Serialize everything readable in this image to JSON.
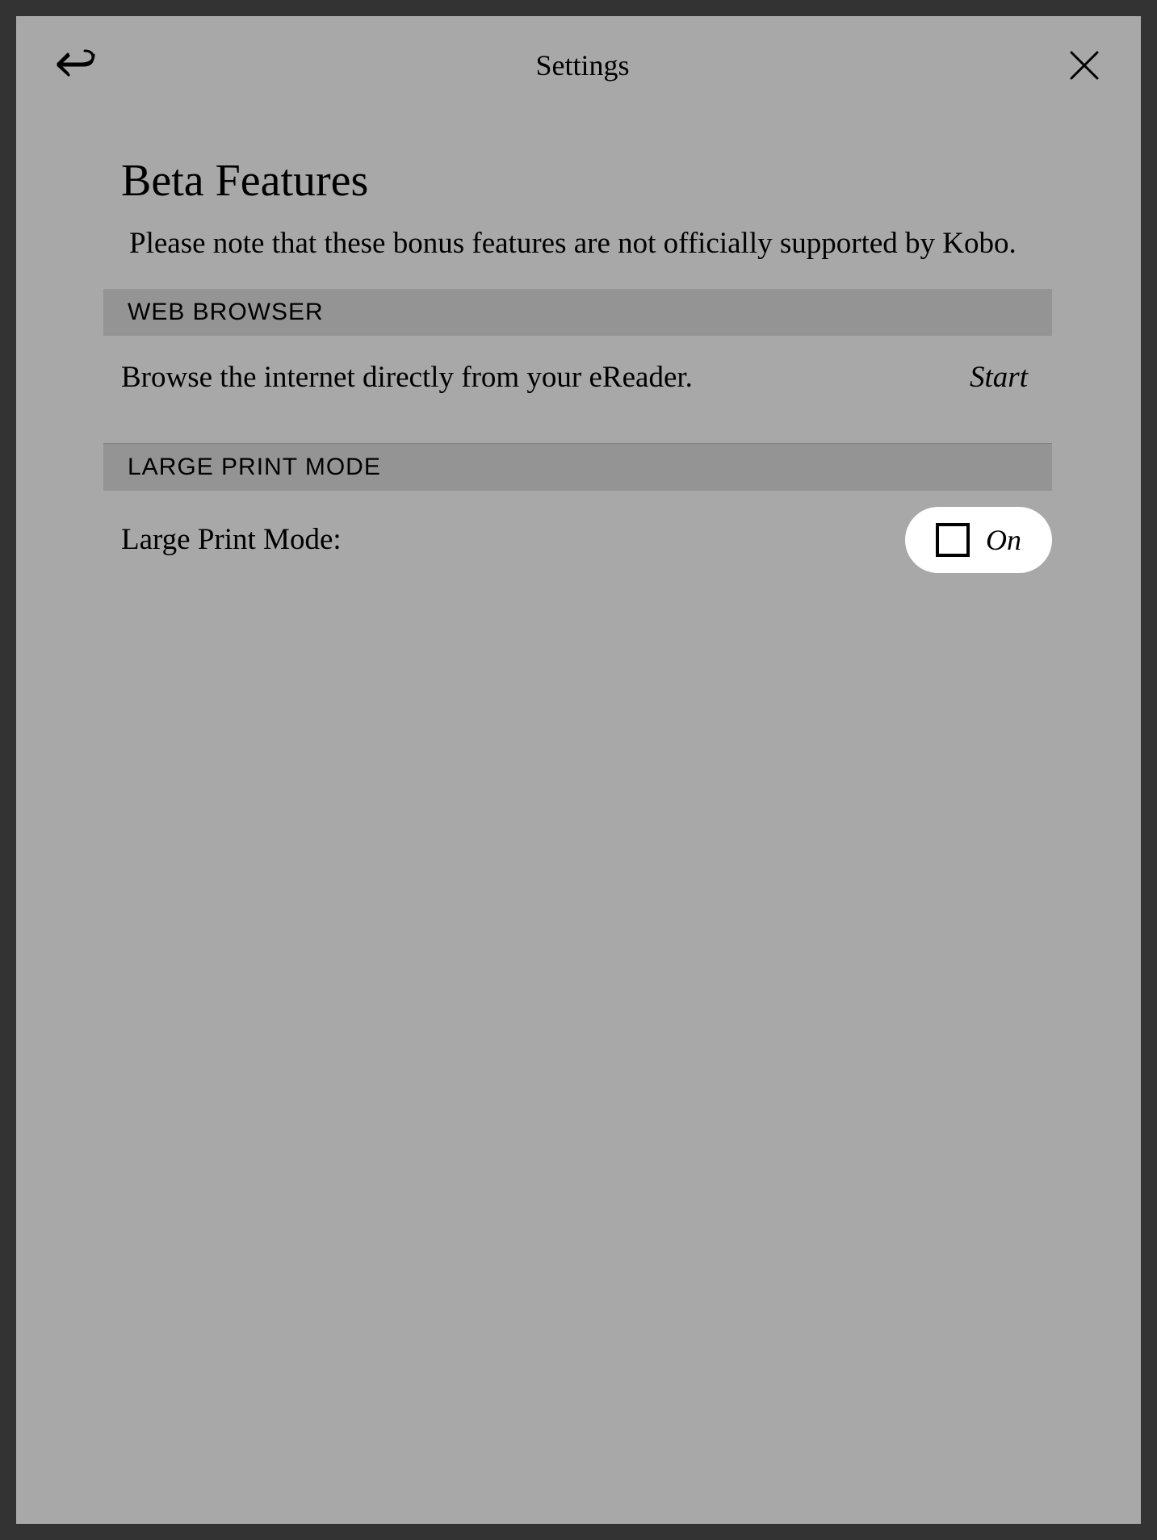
{
  "header": {
    "title": "Settings"
  },
  "page": {
    "title": "Beta Features",
    "description": "Please note that these bonus features are not officially supported by Kobo."
  },
  "sections": {
    "webBrowser": {
      "header": "WEB BROWSER",
      "description": "Browse the internet directly from your eReader.",
      "action": "Start"
    },
    "largePrint": {
      "header": "LARGE PRINT MODE",
      "label": "Large Print Mode:",
      "toggleLabel": "On"
    }
  }
}
